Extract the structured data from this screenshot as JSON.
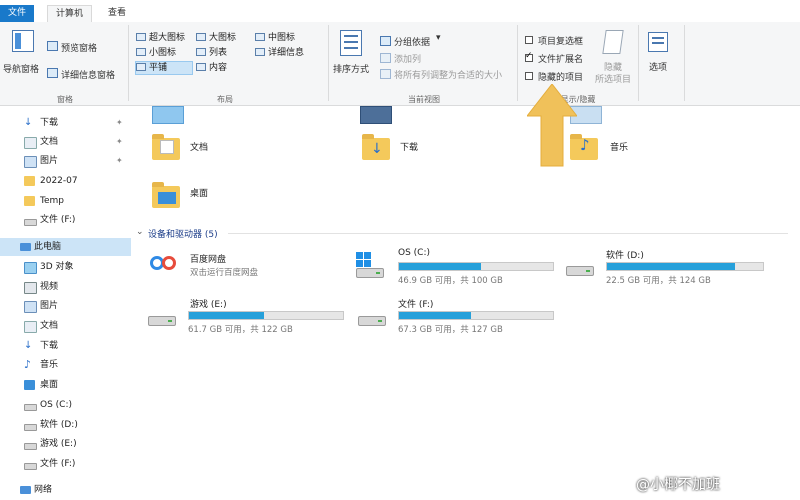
{
  "tabs": {
    "file": "文件",
    "computer": "计算机",
    "view": "查看"
  },
  "ribbon": {
    "pane": {
      "nav_pane": "导航窗格",
      "preview_pane": "预览窗格",
      "details_pane": "详细信息窗格",
      "label": "窗格"
    },
    "layout": {
      "items": [
        "超大图标",
        "大图标",
        "中图标",
        "小图标",
        "列表",
        "详细信息",
        "平铺",
        "内容"
      ],
      "selected": "平铺",
      "label": "布局"
    },
    "current_view": {
      "sort_by": "排序方式",
      "group_by": "分组依据",
      "add_column": "添加列",
      "size_all_columns": "将所有列调整为合适的大小",
      "label": "当前视图"
    },
    "show_hide": {
      "item_checkboxes": "项目复选框",
      "item_checkboxes_checked": false,
      "file_extensions": "文件扩展名",
      "file_extensions_checked": true,
      "hidden_items": "隐藏的项目",
      "hidden_items_checked": false,
      "hide": "隐藏",
      "hide_selected": "所选项目",
      "label": "显示/隐藏"
    },
    "options": "选项"
  },
  "nav": {
    "items": [
      "下载",
      "文档",
      "图片",
      "2022-07",
      "Temp",
      "文件 (F:)",
      "此电脑",
      "3D 对象",
      "视频",
      "图片",
      "文档",
      "下载",
      "音乐",
      "桌面",
      "OS (C:)",
      "软件 (D:)",
      "游戏 (E:)",
      "文件 (F:)",
      "网络"
    ],
    "selected": "此电脑"
  },
  "folders": {
    "documents": "文档",
    "downloads": "下载",
    "music": "音乐",
    "desktop": "桌面"
  },
  "devices": {
    "header": "设备和驱动器 (5)",
    "baidu": {
      "name": "百度网盘",
      "desc": "双击运行百度网盘"
    },
    "drives": [
      {
        "name": "OS (C:)",
        "free": "46.9 GB 可用，共 100 GB",
        "used_fraction": 0.53
      },
      {
        "name": "软件 (D:)",
        "free": "22.5 GB 可用，共 124 GB",
        "used_fraction": 0.82
      },
      {
        "name": "游戏 (E:)",
        "free": "61.7 GB 可用，共 122 GB",
        "used_fraction": 0.49
      },
      {
        "name": "文件 (F:)",
        "free": "67.3 GB 可用，共 127 GB",
        "used_fraction": 0.47
      }
    ]
  },
  "colors": {
    "accent": "#1979ca",
    "bar_fill": "#26a0da",
    "arrow": "#f0c15a",
    "folder": "#f4c95b"
  },
  "watermark": "@小椰不加班"
}
